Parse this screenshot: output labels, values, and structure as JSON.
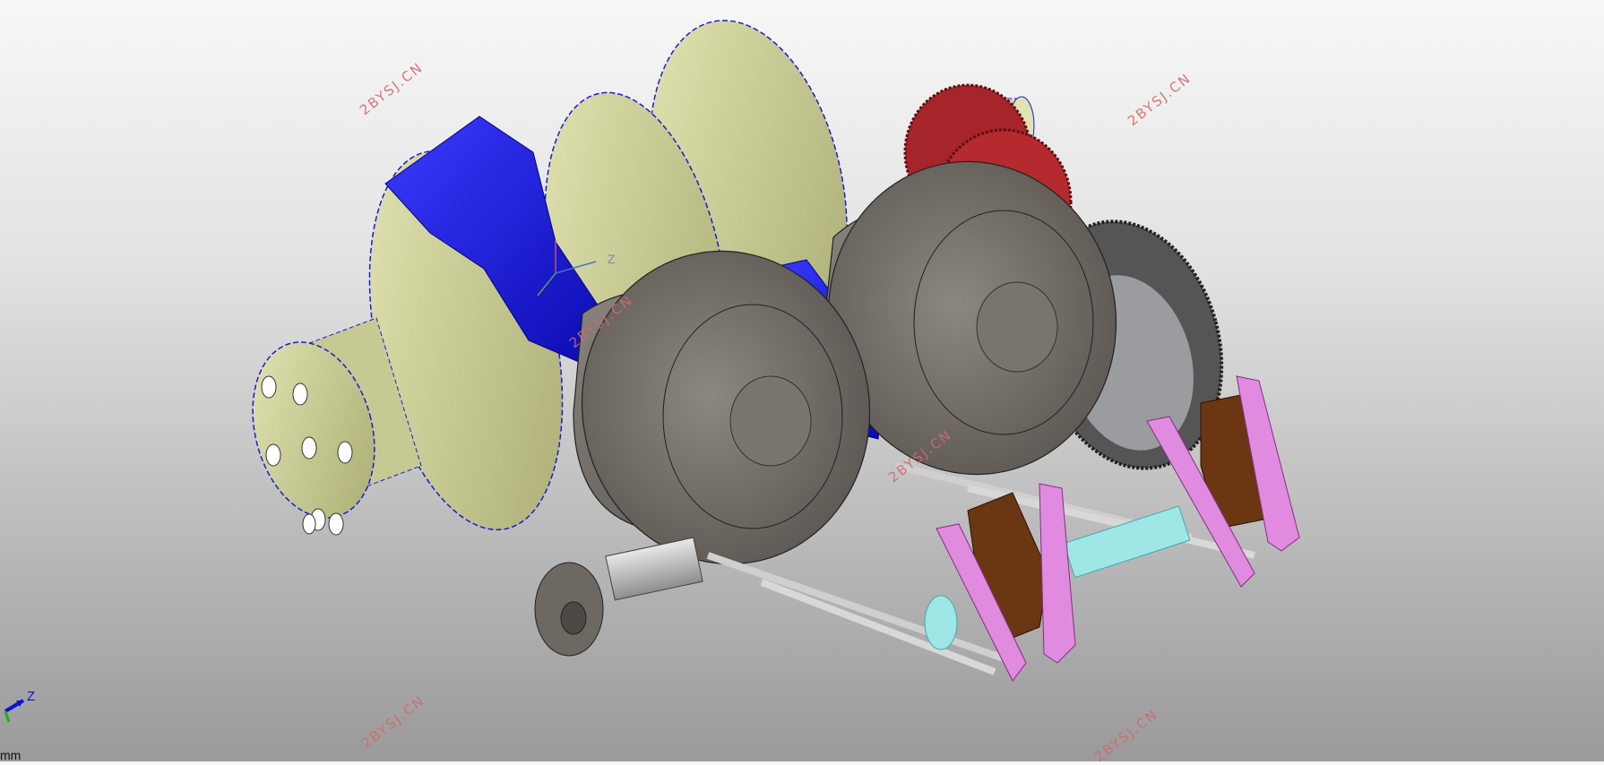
{
  "watermarks": [
    "2BYSJ.CN",
    "2BYSJ.CN",
    "2BYSJ.CN",
    "2BYSJ.CN",
    "2BYSJ.CN",
    "2BYSJ.CN",
    "2BYSJ.CN"
  ],
  "triad": {
    "axis_z": "Z"
  },
  "local_axis": {
    "axis_z": "Z"
  },
  "units": {
    "label": "mm"
  },
  "colors": {
    "crankshaft": "#c9cb95",
    "crank_edge": "#1a1ad6",
    "counterweight": "#1010d8",
    "piston": "#6e6862",
    "gear_red": "#a5252a",
    "gear_dark": "#3a3a3a",
    "rocker_pink": "#e08be0",
    "rocker_brown": "#6b3612",
    "shaft_cyan": "#9fe6e6"
  }
}
